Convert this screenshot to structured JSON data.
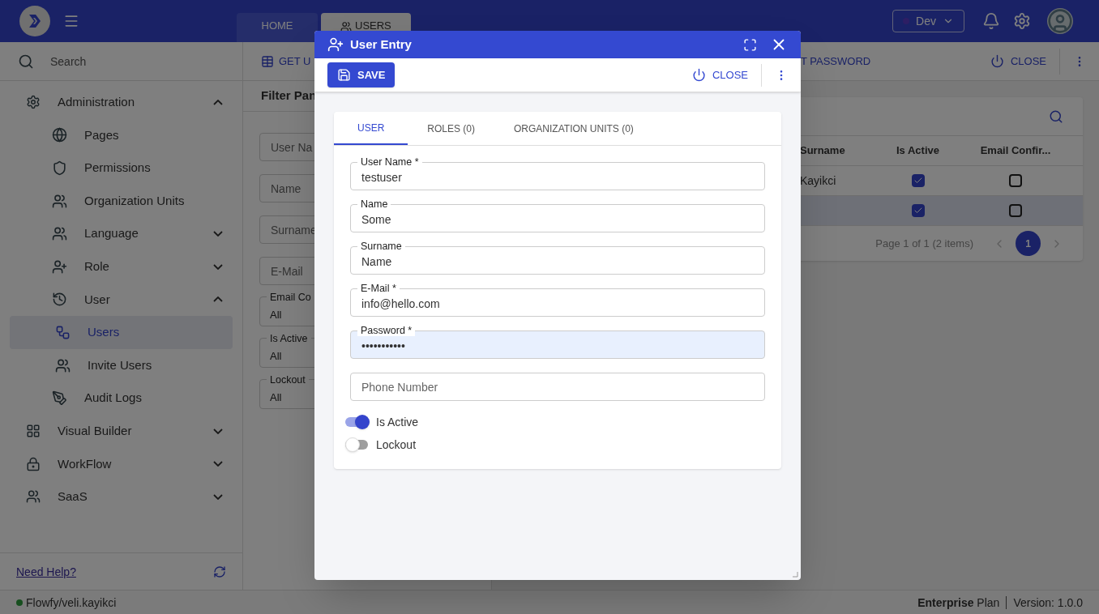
{
  "header": {
    "env": "Dev",
    "tabs": [
      {
        "label": "HOME",
        "selected": false
      },
      {
        "label": "USERS",
        "selected": true
      }
    ]
  },
  "sidebar": {
    "search": {
      "placeholder": "Search"
    },
    "items": [
      {
        "label": "Administration",
        "expanded": true,
        "selected": false,
        "children": [
          {
            "label": "Pages",
            "selected": false
          },
          {
            "label": "Permissions",
            "selected": false
          },
          {
            "label": "Organization Units",
            "selected": false
          },
          {
            "label": "Language",
            "expanded": false,
            "selected": false
          },
          {
            "label": "Role",
            "expanded": false,
            "selected": false
          },
          {
            "label": "User",
            "expanded": true,
            "selected": false,
            "children": [
              {
                "label": "Users",
                "selected": true
              },
              {
                "label": "Invite Users",
                "selected": false
              }
            ]
          },
          {
            "label": "Audit Logs",
            "selected": false
          }
        ]
      },
      {
        "label": "Visual Builder",
        "expanded": false,
        "selected": false
      },
      {
        "label": "WorkFlow",
        "expanded": false,
        "selected": false
      },
      {
        "label": "SaaS",
        "expanded": false,
        "selected": false
      }
    ],
    "help": "Need Help?"
  },
  "toolbar": {
    "buttons": [
      "GET U",
      "T PASSWORD"
    ],
    "close": "CLOSE"
  },
  "filter_panel": {
    "title": "Filter Pan",
    "fields": [
      {
        "kind": "text",
        "placeholder": "User Na"
      },
      {
        "kind": "text",
        "placeholder": "Name"
      },
      {
        "kind": "text",
        "placeholder": "Surname"
      },
      {
        "kind": "text",
        "placeholder": "E-Mail"
      },
      {
        "kind": "select",
        "label": "Email Co",
        "value": "All"
      },
      {
        "kind": "select",
        "label": "Is Active",
        "value": "All"
      },
      {
        "kind": "select",
        "label": "Lockout",
        "value": "All"
      }
    ]
  },
  "grid": {
    "columns": [
      "Surname",
      "Is Active",
      "Email Confir..."
    ],
    "rows": [
      {
        "surname": "Kayikci",
        "is_active": true,
        "email_confirmed": false,
        "selected": false
      },
      {
        "is_active": true,
        "email_confirmed": false,
        "selected": true
      }
    ],
    "pager": "Page 1 of 1 (2 items)",
    "pages": [
      {
        "label": "1",
        "selected": true
      }
    ]
  },
  "dialog": {
    "title": "User Entry",
    "save": "SAVE",
    "close": "CLOSE",
    "tabs": [
      {
        "label": "USER",
        "selected": true
      },
      {
        "label": "ROLES (0)",
        "selected": false
      },
      {
        "label": "ORGANIZATION UNITS (0)",
        "selected": false
      }
    ],
    "fields": [
      {
        "label": "User Name *",
        "value": "testuser",
        "focused": false
      },
      {
        "label": "Name",
        "value": "Some",
        "focused": false
      },
      {
        "label": "Surname",
        "value": "Name",
        "focused": false
      },
      {
        "label": "E-Mail *",
        "value": "info@hello.com",
        "focused": false
      },
      {
        "label": "Password *",
        "value": "•••••••••••",
        "focused": true
      },
      {
        "placeholder": "Phone Number",
        "focused": false
      }
    ],
    "toggles": [
      {
        "label": "Is Active",
        "on": true
      },
      {
        "label": "Lockout",
        "on": false
      }
    ]
  },
  "status_bar": {
    "user": "Flowfy/veli.kayikci",
    "plan": "**Enterprise** Plan",
    "version": "Version: 1.0.0"
  }
}
